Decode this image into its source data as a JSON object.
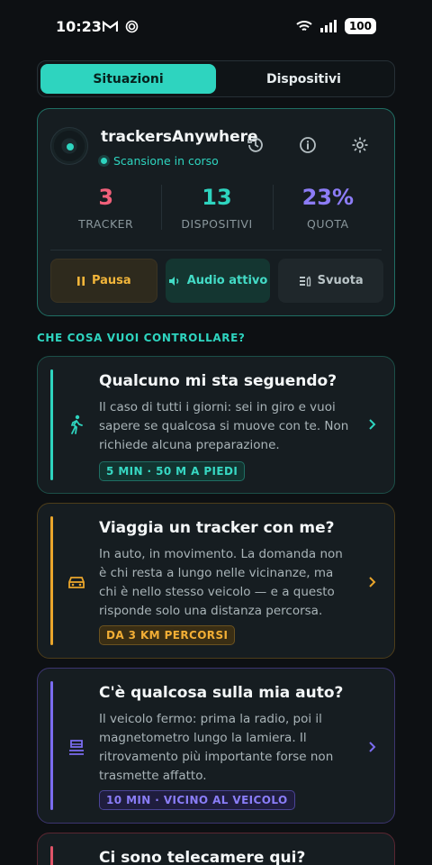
{
  "status_bar": {
    "time": "10:23",
    "battery": "100"
  },
  "tabs": [
    {
      "label": "Situazioni",
      "active": true
    },
    {
      "label": "Dispositivi",
      "active": false
    }
  ],
  "status_card": {
    "app_name": "trackersAnywhere",
    "scan_status": "Scansione in corso",
    "stats": [
      {
        "value": "3",
        "label": "TRACKER",
        "color": "#f0607a"
      },
      {
        "value": "13",
        "label": "DISPOSITIVI",
        "color": "#2ed4bf"
      },
      {
        "value": "23%",
        "label": "QUOTA",
        "color": "#8c7cf6"
      }
    ],
    "actions": {
      "pause": "Pausa",
      "audio": "Audio attivo",
      "clear": "Svuota"
    }
  },
  "section_title": "CHE COSA VUOI CONTROLLARE?",
  "questions": [
    {
      "title": "Qualcuno mi sta seguendo?",
      "description": "Il caso di tutti i giorni: sei in giro e vuoi sapere se qualcosa si muove con te. Non richiede alcuna preparazione.",
      "badge": "5 MIN · 50 M A PIEDI",
      "icon": "walking-icon",
      "accent": "#2ed4bf"
    },
    {
      "title": "Viaggia un tracker con me?",
      "description": "In auto, in movimento. La domanda non è chi resta a lungo nelle vicinanze, ma chi è nello stesso veicolo — e a questo risponde solo una distanza percorsa.",
      "badge": "DA 3 KM PERCORSI",
      "icon": "car-icon",
      "accent": "#e9a52b"
    },
    {
      "title": "C'è qualcosa sulla mia auto?",
      "description": "Il veicolo fermo: prima la radio, poi il magnetometro lungo la lamiera. Il ritrovamento più importante forse non trasmette affatto.",
      "badge": "10 MIN · VICINO AL VEICOLO",
      "icon": "vehicle-scan-icon",
      "accent": "#7b6cf0"
    },
    {
      "title": "Ci sono telecamere qui?",
      "accent": "#e05468"
    }
  ]
}
